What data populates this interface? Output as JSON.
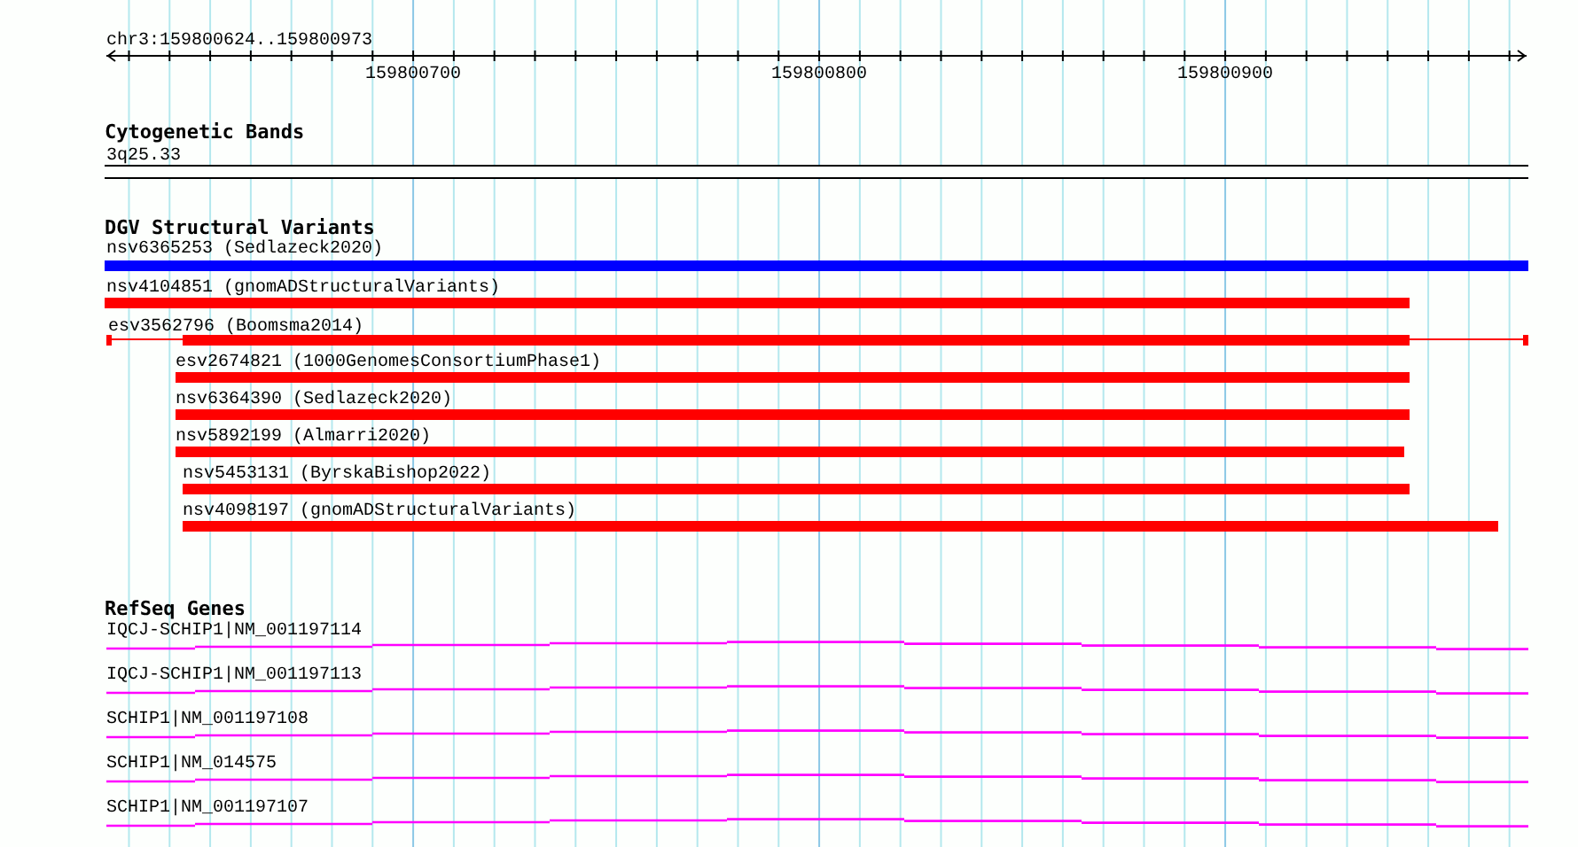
{
  "ruler": {
    "location": "chr3:159800624..159800973",
    "ticks": [
      "159800700",
      "159800800",
      "159800900"
    ]
  },
  "tracks": [
    {
      "kind": "bands",
      "title": "Cytogenetic Bands",
      "bands": [
        "3q25.33"
      ]
    },
    {
      "kind": "variants",
      "title": "DGV Structural Variants",
      "features": [
        {
          "label": "nsv6365253 (Sedlazeck2020)",
          "color": "#0000ff"
        },
        {
          "label": "nsv4104851 (gnomADStructuralVariants)",
          "color": "#ff0000"
        },
        {
          "label": "esv3562796 (Boomsma2014)",
          "color": "#ff0000"
        },
        {
          "label": "esv2674821 (1000GenomesConsortiumPhase1)",
          "color": "#ff0000"
        },
        {
          "label": "nsv6364390 (Sedlazeck2020)",
          "color": "#ff0000"
        },
        {
          "label": "nsv5892199 (Almarri2020)",
          "color": "#ff0000"
        },
        {
          "label": "nsv5453131 (ByrskaBishop2022)",
          "color": "#ff0000"
        },
        {
          "label": "nsv4098197 (gnomADStructuralVariants)",
          "color": "#ff0000"
        }
      ]
    },
    {
      "kind": "genes",
      "title": "RefSeq Genes",
      "genes": [
        "IQCJ-SCHIP1|NM_001197114",
        "IQCJ-SCHIP1|NM_001197113",
        "SCHIP1|NM_001197108",
        "SCHIP1|NM_014575",
        "SCHIP1|NM_001197107"
      ]
    }
  ]
}
